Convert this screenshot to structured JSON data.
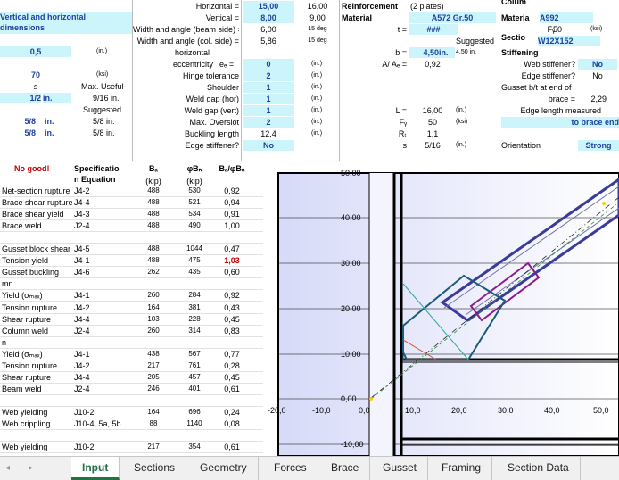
{
  "top": {
    "vert_horiz_title": "Vertical and horizontal dimensions",
    "vhd_value": "0,5",
    "vhd_unit": "(in.)",
    "ksi_value": "70",
    "ksi_unit": "(ksi)",
    "s_label": "s",
    "max_useful": "Max. Useful",
    "half_in": "1/2",
    "half_unit": "in.",
    "nine16": "9/16 in.",
    "suggested": "Suggested",
    "row9a": "5/8",
    "row9b": "in.",
    "row9c": "5/8 in.",
    "row10a": "5/8",
    "row10b": "in.",
    "row10c": "5/8 in.",
    "horizontal_lbl": "Horizontal =",
    "horizontal_val": "15,00",
    "horizontal_b": "16,00",
    "vertical_lbl": "Vertical =",
    "vertical_val": "8,00",
    "vertical_b": "9,00",
    "wab_lbl": "Width and angle (beam side) =",
    "wab_v": "6,00",
    "wab_d": "15 deg",
    "wac_lbl": "Width and angle (col. side) =",
    "wac_v": "5,86",
    "wac_d": "15 deg",
    "horizontal2": "horizontal",
    "ecc_lbl": "eccentricity",
    "eb_lbl": "eₑ =",
    "eb_val": "0",
    "eb_unit": "(in.)",
    "hinge_lbl": "Hinge tolerance",
    "hinge_val": "2",
    "hinge_unit": "(in.)",
    "shoulder_lbl": "Shoulder",
    "shoulder_val": "1",
    "shoulder_unit": "(in.)",
    "wgh_lbl": "Weld gap (hor)",
    "wgh_val": "1",
    "wgh_unit": "(in.)",
    "wgv_lbl": "Weld gap (vert)",
    "wgv_val": "1",
    "wgv_unit": "(in.)",
    "mo_lbl": "Max. Overslot",
    "mo_val": "2",
    "mo_unit": "(in.)",
    "bl_lbl": "Buckling length",
    "bl_val": "12,4",
    "bl_unit": "(in.)",
    "es_lbl": "Edge stiffener?",
    "es_val": "No",
    "reinf": "Reinforcement",
    "reinf2": "(2 plates)",
    "mat_lbl": "Material",
    "mat_val": "A572 Gr.50",
    "t_lbl": "t =",
    "t_val": "###",
    "sugg2": "Suggested",
    "b_lbl": "b =",
    "b_val": "4,50",
    "b_unit": "in.",
    "b_sugg": "4,50 in.",
    "aa_lbl": "A/ Aₑ =",
    "aa_val": "0,92",
    "L_lbl": "L =",
    "L_val": "16,00",
    "L_unit": "(in.)",
    "Fy_lbl": "Fᵧ",
    "Fy_val": "50",
    "Fy_unit": "(ksi)",
    "Rt_lbl": "Rₜ",
    "Rt_val": "1,1",
    "s2_lbl": "s",
    "s2_val": "5/16",
    "s2_unit": "(in.)",
    "colum": "Colum",
    "material2": "Materia",
    "mat2_val": "A992",
    "fy2": "Fᵧ",
    "fy2_val": "50",
    "fy2_unit": "(ksi)",
    "section": "Sectio",
    "section_val": "W12X152",
    "stiffening": "Stiffening",
    "ws_lbl": "Web stiffener?",
    "ws_val": "No",
    "edge_lbl": "Edge stiffener?",
    "edge_val": "No",
    "gusset_lbl": "Gusset b/t at end of",
    "brace_lbl": "brace =",
    "brace_val": "2,29",
    "edge_len": "Edge length measured",
    "to_brace": "to brace end",
    "orient_lbl": "Orientation",
    "orient_val": "Strong"
  },
  "checks": {
    "status": "No good!",
    "h_spec": "Specificatio",
    "h_spec2": "n Equation",
    "h_b1": "Bₐ",
    "h_b1u": "(kip)",
    "h_b2": "φBₙ",
    "h_b2u": "(kip)",
    "h_b3": "Bₐ/φBₙ",
    "rows": [
      {
        "name": "Net-section rupture",
        "spec": "J4-2",
        "a": "488",
        "b": "530",
        "r": "0,92",
        "red": false
      },
      {
        "name": "Brace shear rupture",
        "spec": "J4-4",
        "a": "488",
        "b": "521",
        "r": "0,94",
        "red": false
      },
      {
        "name": "Brace shear yield",
        "spec": "J4-3",
        "a": "488",
        "b": "534",
        "r": "0,91",
        "red": false
      },
      {
        "name": "Brace weld",
        "spec": "J2-4",
        "a": "488",
        "b": "490",
        "r": "1,00",
        "red": false
      },
      {
        "name": "",
        "spec": "",
        "a": "",
        "b": "",
        "r": "",
        "red": false
      },
      {
        "name": "Gusset block shear",
        "spec": "J4-5",
        "a": "488",
        "b": "1044",
        "r": "0,47",
        "red": false
      },
      {
        "name": "Tension yield",
        "spec": "J4-1",
        "a": "488",
        "b": "475",
        "r": "1,03",
        "red": true
      },
      {
        "name": "Gusset buckling",
        "spec": "J4-6",
        "a": "262",
        "b": "435",
        "r": "0,60",
        "red": false
      },
      {
        "name": "mn",
        "spec": "",
        "a": "",
        "b": "",
        "r": "",
        "red": false
      },
      {
        "name": "Yield (σₘₐₓ)",
        "spec": "J4-1",
        "a": "260",
        "b": "284",
        "r": "0,92",
        "red": false
      },
      {
        "name": "Tension rupture",
        "spec": "J4-2",
        "a": "164",
        "b": "381",
        "r": "0,43",
        "red": false
      },
      {
        "name": "Shear rupture",
        "spec": "J4-4",
        "a": "103",
        "b": "228",
        "r": "0,45",
        "red": false
      },
      {
        "name": "Column weld",
        "spec": "J2-4",
        "a": "260",
        "b": "314",
        "r": "0,83",
        "red": false
      },
      {
        "name": "n",
        "spec": "",
        "a": "",
        "b": "",
        "r": "",
        "red": false
      },
      {
        "name": "Yield (σₘₐₓ)",
        "spec": "J4-1",
        "a": "438",
        "b": "567",
        "r": "0,77",
        "red": false
      },
      {
        "name": "Tension rupture",
        "spec": "J4-2",
        "a": "217",
        "b": "761",
        "r": "0,28",
        "red": false
      },
      {
        "name": "Shear rupture",
        "spec": "J4-4",
        "a": "205",
        "b": "457",
        "r": "0,45",
        "red": false
      },
      {
        "name": "Beam weld",
        "spec": "J2-4",
        "a": "246",
        "b": "401",
        "r": "0,61",
        "red": false
      },
      {
        "name": "",
        "spec": "",
        "a": "",
        "b": "",
        "r": "",
        "red": false
      },
      {
        "name": "Web yielding",
        "spec": "J10-2",
        "a": "164",
        "b": "696",
        "r": "0,24",
        "red": false
      },
      {
        "name": "Web crippling",
        "spec": "J10-4, 5a, 5b",
        "a": "88",
        "b": "1140",
        "r": "0,08",
        "red": false
      },
      {
        "name": "",
        "spec": "",
        "a": "",
        "b": "",
        "r": "",
        "red": false
      },
      {
        "name": "Web yielding",
        "spec": "J10-2",
        "a": "217",
        "b": "354",
        "r": "0,61",
        "red": false
      }
    ]
  },
  "chart": {
    "x_ticks": [
      "-20,0",
      "-10,0",
      "0,0",
      "10,0",
      "20,0",
      "30,0",
      "40,0",
      "50,0"
    ],
    "y_ticks": [
      "50,00",
      "40,00",
      "30,00",
      "20,00",
      "10,00",
      "0,00",
      "-10,00"
    ]
  },
  "tabs": [
    "Input",
    "Sections",
    "Geometry",
    "Forces",
    "Brace",
    "Gusset",
    "Framing",
    "Section Data",
    "("
  ],
  "colors": {
    "accent": "#217346",
    "input_bg": "#ccf5fb",
    "blue_text": "#1f3f9f",
    "red": "#c00000"
  }
}
